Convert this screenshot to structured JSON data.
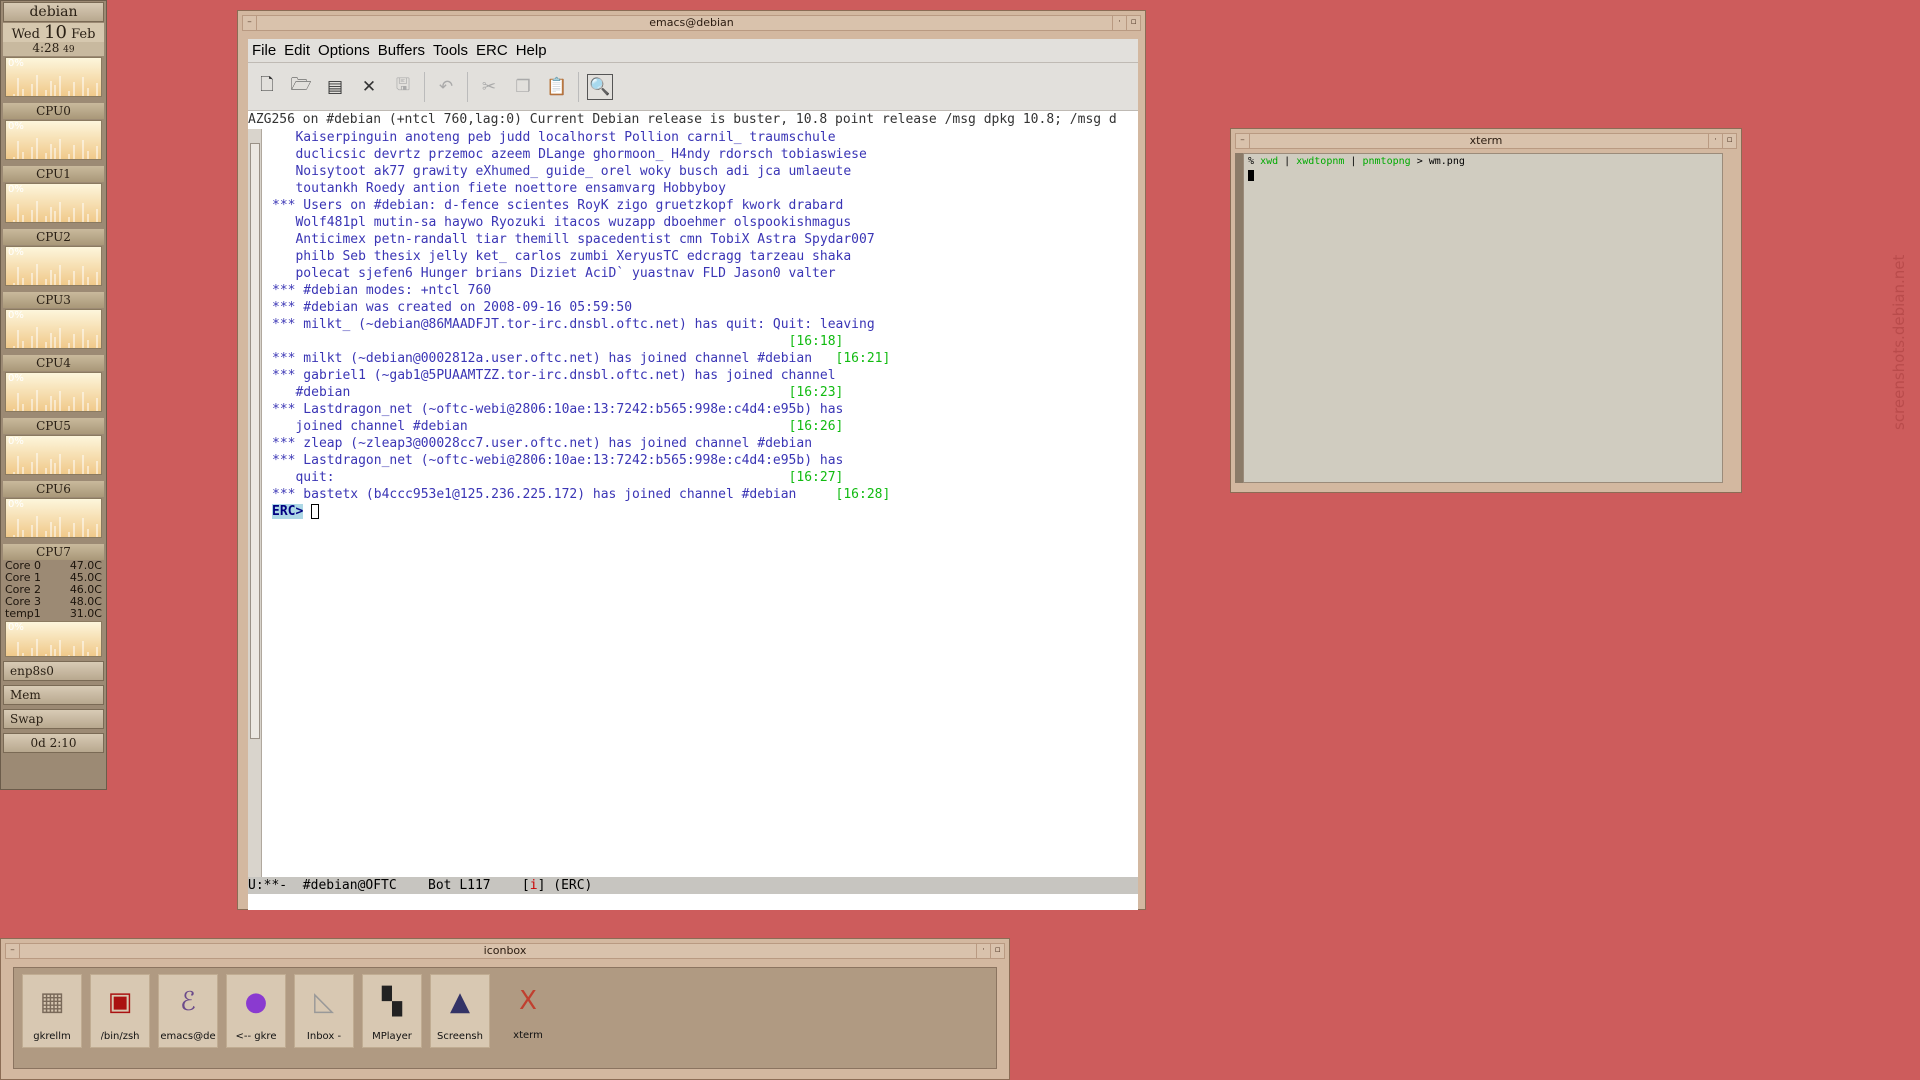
{
  "gkrellm": {
    "hostname": "debian",
    "date_prefix": "Wed",
    "date_day": "10",
    "date_month": "Feb",
    "time": "4:28",
    "time_seconds": "49",
    "percent": "0%",
    "cpus": [
      "CPU0",
      "CPU1",
      "CPU2",
      "CPU3",
      "CPU4",
      "CPU5",
      "CPU6",
      "CPU7"
    ],
    "temps": [
      {
        "name": "Core 0",
        "value": "47.0C"
      },
      {
        "name": "Core 1",
        "value": "45.0C"
      },
      {
        "name": "Core 2",
        "value": "46.0C"
      },
      {
        "name": "Core 3",
        "value": "48.0C"
      },
      {
        "name": "temp1",
        "value": "31.0C"
      }
    ],
    "net_label": "enp8s0",
    "mem_label": "Mem",
    "swap_label": "Swap",
    "uptime": "0d  2:10"
  },
  "emacs": {
    "title": "emacs@debian",
    "menu": [
      "File",
      "Edit",
      "Options",
      "Buffers",
      "Tools",
      "ERC",
      "Help"
    ],
    "toolbar_icons": [
      "new-file-icon",
      "open-folder-icon",
      "dired-icon",
      "close-icon",
      "save-icon",
      "undo-icon",
      "cut-icon",
      "copy-icon",
      "paste-icon",
      "search-icon"
    ],
    "header_line": "AZG256 on #debian (+ntcl 760,lag:0) Current Debian release is buster, 10.8 point release /msg dpkg 10.8; /msg d",
    "lines": [
      {
        "text": "   Kaiserpinguin anoteng peb judd localhorst Pollion carnil_ traumschule",
        "ts": ""
      },
      {
        "text": "   duclicsic devrtz przemoc azeem DLange ghormoon_ H4ndy rdorsch tobiaswiese",
        "ts": ""
      },
      {
        "text": "   Noisytoot ak77 grawity eXhumed_ guide_ orel woky busch adi jca umlaeute",
        "ts": ""
      },
      {
        "text": "   toutankh Roedy antion fiete noettore ensamvarg Hobbyboy",
        "ts": ""
      },
      {
        "text": "*** Users on #debian: d-fence scientes RoyK zigo gruetzkopf kwork drabard",
        "ts": ""
      },
      {
        "text": "   Wolf481pl mutin-sa haywo Ryozuki itacos wuzapp dboehmer olspookishmagus",
        "ts": ""
      },
      {
        "text": "   Anticimex petn-randall tiar themill spacedentist cmn TobiX Astra Spydar007",
        "ts": ""
      },
      {
        "text": "   philb Seb thesix jelly ket_ carlos zumbi XeryusTC edcragg tarzeau shaka",
        "ts": ""
      },
      {
        "text": "   polecat sjefen6 Hunger brians Diziet AciD` yuastnav FLD Jason0 valter",
        "ts": ""
      },
      {
        "text": "*** #debian modes: +ntcl 760",
        "ts": ""
      },
      {
        "text": "*** #debian was created on 2008-09-16 05:59:50",
        "ts": ""
      },
      {
        "text": "*** milkt_ (~debian@86MAADFJT.tor-irc.dnsbl.oftc.net) has quit: Quit: leaving",
        "ts": ""
      },
      {
        "text": "                                                                  ",
        "ts": "[16:18]"
      },
      {
        "text": "*** milkt (~debian@0002812a.user.oftc.net) has joined channel #debian   ",
        "ts": "[16:21]"
      },
      {
        "text": "*** gabriel1 (~gab1@5PUAAMTZZ.tor-irc.dnsbl.oftc.net) has joined channel",
        "ts": ""
      },
      {
        "text": "   #debian                                                        ",
        "ts": "[16:23]"
      },
      {
        "text": "*** Lastdragon_net (~oftc-webi@2806:10ae:13:7242:b565:998e:c4d4:e95b) has",
        "ts": ""
      },
      {
        "text": "   joined channel #debian                                         ",
        "ts": "[16:26]"
      },
      {
        "text": "*** zleap (~zleap3@00028cc7.user.oftc.net) has joined channel #debian",
        "ts": ""
      },
      {
        "text": "*** Lastdragon_net (~oftc-webi@2806:10ae:13:7242:b565:998e:c4d4:e95b) has",
        "ts": ""
      },
      {
        "text": "   quit:                                                          ",
        "ts": "[16:27]"
      },
      {
        "text": "*** bastetx (b4ccc953e1@125.236.225.172) has joined channel #debian     ",
        "ts": "[16:28]"
      }
    ],
    "prompt": "ERC>",
    "modeline": {
      "left": "U:**-  #debian@OFTC    Bot L117    [",
      "indicator": "i",
      "right": "] (ERC)"
    }
  },
  "xterm": {
    "title": "xterm",
    "prompt": "%",
    "cmd1": "xwd",
    "pipe": "|",
    "cmd2": "xwdtopnm",
    "cmd3": "pnmtopng",
    "redirect": ">",
    "file": "wm.png"
  },
  "iconbox": {
    "title": "iconbox",
    "icons": [
      {
        "label": "gkrellm",
        "icon": "gkrellm-icon",
        "glyph": "▦",
        "color": "#7a6a5a"
      },
      {
        "label": "/bin/zsh",
        "icon": "terminal-icon",
        "glyph": "▣",
        "color": "#aa1111"
      },
      {
        "label": "emacs@de",
        "icon": "emacs-icon",
        "glyph": "ℰ",
        "color": "#6b4a8a"
      },
      {
        "label": "<-- gkre",
        "icon": "firefox-icon",
        "glyph": "●",
        "color": "#8a3ad0"
      },
      {
        "label": "Inbox -",
        "icon": "mail-icon",
        "glyph": "◺",
        "color": "#999"
      },
      {
        "label": "MPlayer",
        "icon": "mplayer-icon",
        "glyph": "▚",
        "color": "#222"
      },
      {
        "label": "Screensh",
        "icon": "screenshot-icon",
        "glyph": "▲",
        "color": "#336"
      },
      {
        "label": "xterm",
        "icon": "xterm-icon",
        "glyph": "X",
        "color": "#c04030"
      }
    ]
  },
  "watermark": "screenshots.debian.net"
}
